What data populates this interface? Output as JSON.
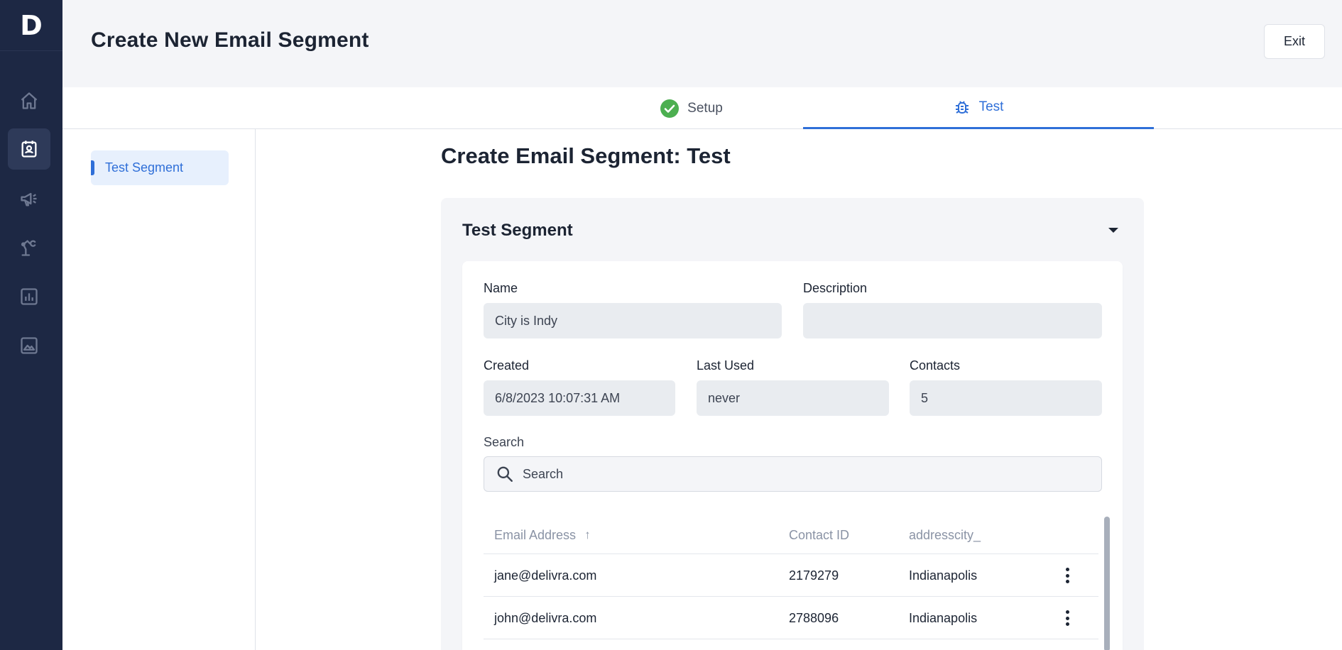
{
  "app": {
    "logo_letter": "D"
  },
  "sidebar": {
    "items": [
      {
        "icon": "home-icon",
        "active": false
      },
      {
        "icon": "contacts-icon",
        "active": true
      },
      {
        "icon": "megaphone-icon",
        "active": false
      },
      {
        "icon": "automation-icon",
        "active": false
      },
      {
        "icon": "reports-icon",
        "active": false
      },
      {
        "icon": "image-icon",
        "active": false
      }
    ]
  },
  "header": {
    "title": "Create New Email Segment",
    "exit_label": "Exit"
  },
  "steps": [
    {
      "label": "Setup",
      "status": "complete",
      "icon": "check-circle-icon"
    },
    {
      "label": "Test",
      "status": "active",
      "icon": "bug-icon"
    }
  ],
  "side_panel": {
    "item": "Test Segment"
  },
  "main": {
    "title": "Create Email Segment: Test"
  },
  "segment": {
    "section_title": "Test Segment",
    "name_label": "Name",
    "name_value": "City is Indy",
    "description_label": "Description",
    "description_value": "",
    "created_label": "Created",
    "created_value": "6/8/2023 10:07:31 AM",
    "last_used_label": "Last Used",
    "last_used_value": "never",
    "contacts_label": "Contacts",
    "contacts_value": "5"
  },
  "search": {
    "label": "Search",
    "placeholder": "Search"
  },
  "table": {
    "columns": [
      "Email Address",
      "Contact ID",
      "addresscity_"
    ],
    "sort_indicator": "↑",
    "rows": [
      {
        "email": "jane@delivra.com",
        "contact_id": "2179279",
        "city": "Indianapolis"
      },
      {
        "email": "john@delivra.com",
        "contact_id": "2788096",
        "city": "Indianapolis"
      }
    ]
  },
  "colors": {
    "accent": "#2f6fd8",
    "sidebar_bg": "#1d2844",
    "success": "#4caf50"
  }
}
